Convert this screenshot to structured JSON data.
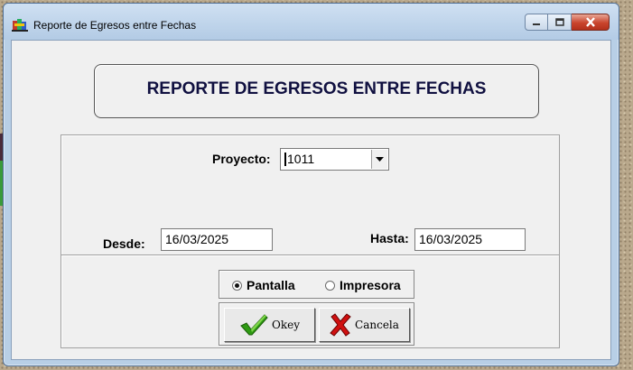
{
  "window": {
    "title": "Reporte de Egresos entre Fechas",
    "icon": "app-colorful-icon"
  },
  "header": {
    "title": "REPORTE DE EGRESOS ENTRE FECHAS"
  },
  "form": {
    "proyecto_label": "Proyecto:",
    "proyecto_value": "1011",
    "desde_label": "Desde:",
    "desde_value": "16/03/2025",
    "hasta_label": "Hasta:",
    "hasta_value": "16/03/2025"
  },
  "output": {
    "options": [
      {
        "label": "Pantalla",
        "selected": true
      },
      {
        "label": "Impresora",
        "selected": false
      }
    ]
  },
  "buttons": {
    "ok_label": "Okey",
    "cancel_label": "Cancela"
  },
  "colors": {
    "titlebar": "#b8cfe6",
    "close_button": "#c9452d",
    "check_green": "#2e9a12",
    "cross_red": "#d01010",
    "header_text": "#101040"
  }
}
